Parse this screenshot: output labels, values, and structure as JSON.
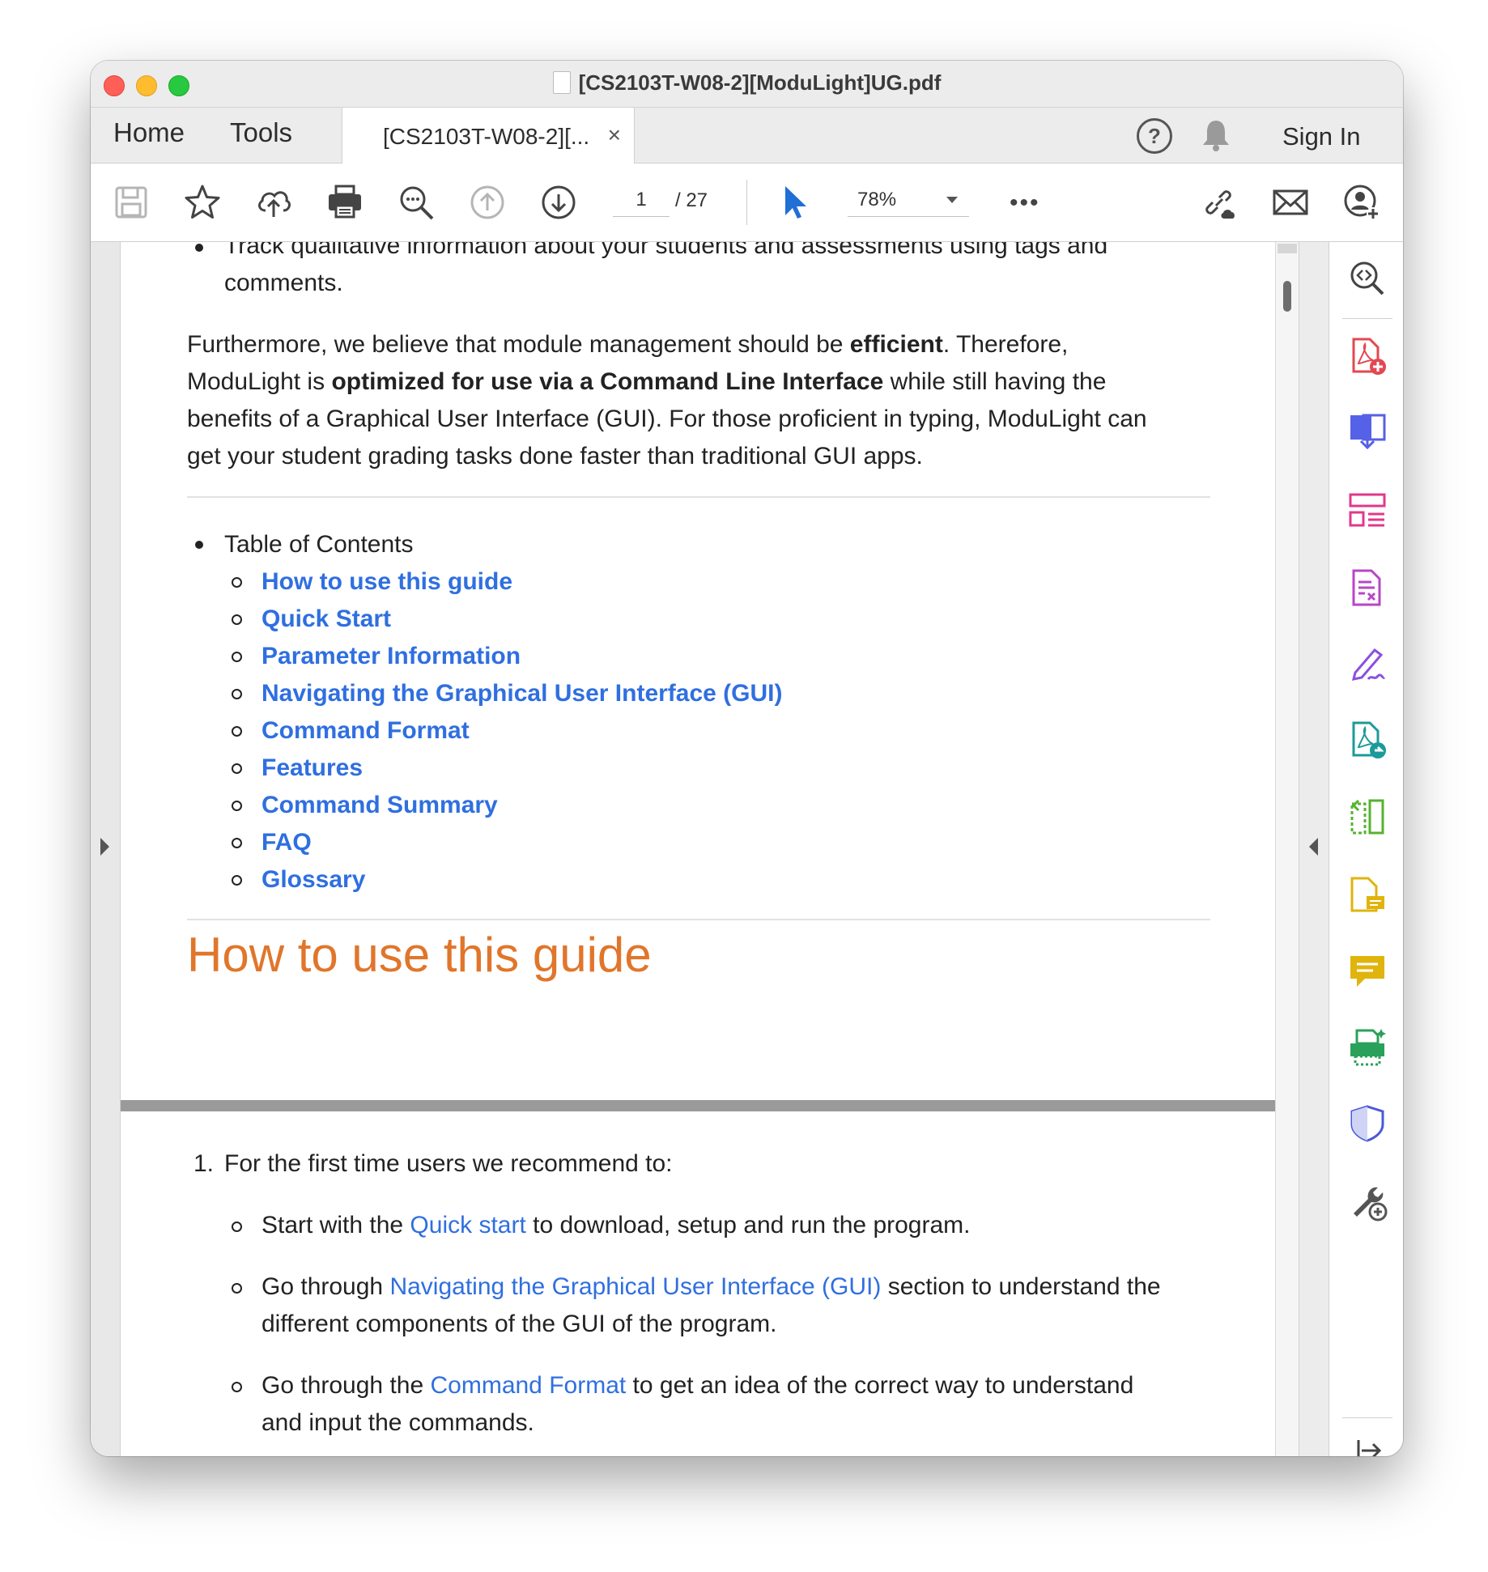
{
  "window": {
    "title": "[CS2103T-W08-2][ModuLight]UG.pdf"
  },
  "tabs": {
    "home": "Home",
    "tools": "Tools",
    "document": "[CS2103T-W08-2][...",
    "close": "×"
  },
  "header": {
    "help": "?",
    "sign_in": "Sign In"
  },
  "toolbar": {
    "page_current": "1",
    "page_total": "/ 27",
    "zoom": "78%",
    "more": "•••"
  },
  "document": {
    "top_bullet_line1": "Track qualitative information about your students and assessments using tags and",
    "top_bullet_line2": "comments.",
    "para": {
      "l1_a": "Furthermore, we believe that module management should be ",
      "l1_b": "efficient",
      "l1_c": ". Therefore,",
      "l2_a": "ModuLight is ",
      "l2_b": "optimized for use via a Command Line Interface",
      "l2_c": " while still having the",
      "l3": "benefits of a Graphical User Interface (GUI). For those proficient in typing, ModuLight can",
      "l4": "get your student grading tasks done faster than traditional GUI apps."
    },
    "toc_title": "Table of Contents",
    "toc": [
      "How to use this guide",
      "Quick Start",
      "Parameter Information",
      "Navigating the Graphical User Interface (GUI)",
      "Command Format",
      "Features",
      "Command Summary",
      "FAQ",
      "Glossary"
    ],
    "heading": "How to use this guide",
    "list_item_number": "1.",
    "list_item_text": "For the first time users we recommend to:",
    "sub": {
      "s1_a": "Start with the ",
      "s1_link": "Quick start",
      "s1_b": " to download, setup and run the program.",
      "s2_a": "Go through ",
      "s2_link": "Navigating the Graphical User Interface (GUI)",
      "s2_b": " section to understand the",
      "s2_c": "different components of the GUI of the program.",
      "s3_a": "Go through the ",
      "s3_link": "Command Format",
      "s3_b": " to get an idea of the correct way to understand",
      "s3_c": "and input the commands."
    }
  },
  "colors": {
    "link": "#2f6fe0",
    "heading": "#e0762b"
  }
}
